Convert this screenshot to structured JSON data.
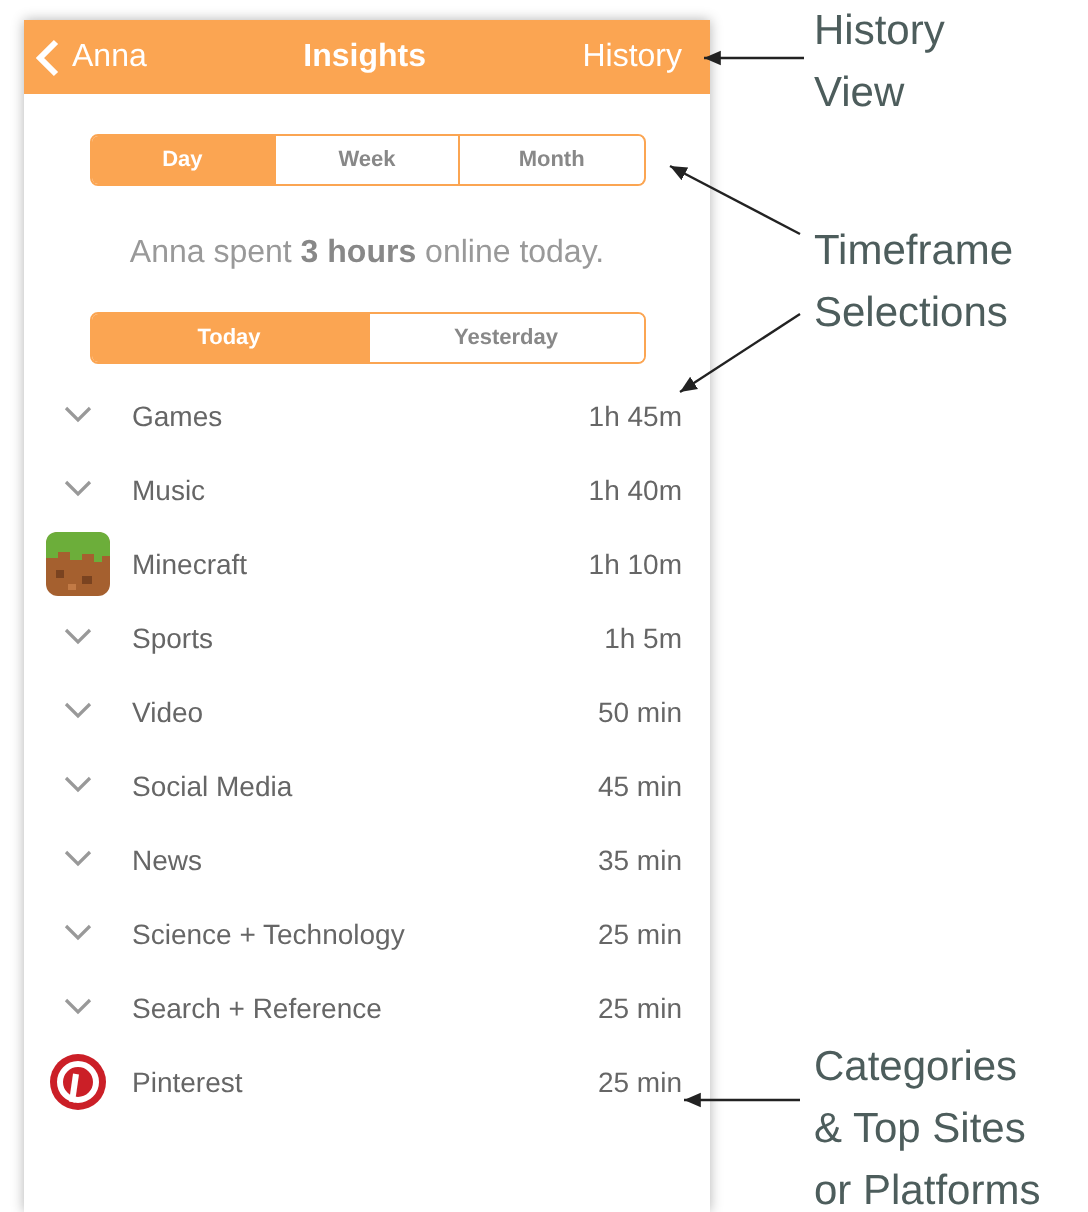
{
  "header": {
    "back_label": "Anna",
    "title": "Insights",
    "action": "History"
  },
  "periods": [
    {
      "label": "Day",
      "selected": true
    },
    {
      "label": "Week",
      "selected": false
    },
    {
      "label": "Month",
      "selected": false
    }
  ],
  "summary": "Anna spent **3 hours** online today.",
  "days": [
    {
      "label": "Today",
      "selected": true
    },
    {
      "label": "Yesterday",
      "selected": false
    }
  ],
  "rows": [
    {
      "kind": "category",
      "name": "Games",
      "time": "1h 45m"
    },
    {
      "kind": "category",
      "name": "Music",
      "time": "1h 40m"
    },
    {
      "kind": "block-app",
      "name": "Minecraft",
      "time": "1h 10m"
    },
    {
      "kind": "category",
      "name": "Sports",
      "time": "1h 5m"
    },
    {
      "kind": "category",
      "name": "Video",
      "time": "50 min"
    },
    {
      "kind": "category",
      "name": "Social Media",
      "time": "45 min"
    },
    {
      "kind": "category",
      "name": "News",
      "time": "35 min"
    },
    {
      "kind": "category",
      "name": "Science + Technology",
      "time": "25 min"
    },
    {
      "kind": "category",
      "name": "Search + Reference",
      "time": "25 min"
    },
    {
      "kind": "pin-app",
      "name": "Pinterest",
      "time": "25 min"
    }
  ],
  "annotations": [
    {
      "lines": [
        "History",
        "View"
      ]
    },
    {
      "lines": [
        "Timeframe",
        "Selections"
      ]
    },
    {
      "lines": [
        "Categories",
        "& Top Sites",
        "or Platforms"
      ]
    }
  ]
}
